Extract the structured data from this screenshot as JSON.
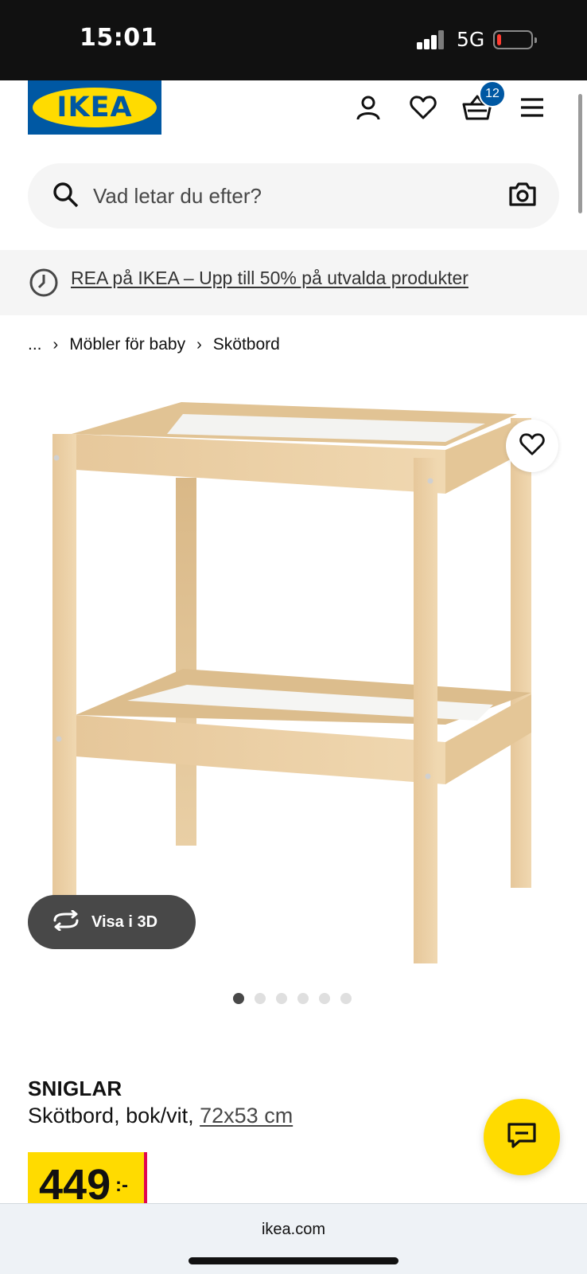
{
  "status_bar": {
    "time": "15:01",
    "network": "5G",
    "battery_level": 0.12,
    "battery_color": "#ff3b30"
  },
  "header": {
    "logo_text": "IKEA",
    "brand_blue": "#0058a3",
    "brand_yellow": "#ffdb00",
    "cart_count": "12",
    "icons": [
      "account-icon",
      "heart-icon",
      "cart-icon",
      "menu-icon"
    ]
  },
  "search": {
    "placeholder": "Vad letar du efter?",
    "icons": [
      "search-icon",
      "camera-icon"
    ]
  },
  "promo": {
    "text": "REA på IKEA – Upp till 50% på utvalda produkter",
    "icon": "clock-icon"
  },
  "breadcrumb": {
    "items": [
      "...",
      "Möbler för baby",
      "Skötbord"
    ]
  },
  "gallery": {
    "view_3d_label": "Visa i 3D",
    "image_count": 6,
    "active_index": 0
  },
  "product": {
    "name": "SNIGLAR",
    "description": "Skötbord, bok/vit,",
    "size": "72x53 cm",
    "price": "449",
    "price_suffix": ":-"
  },
  "browser": {
    "url": "ikea.com"
  }
}
